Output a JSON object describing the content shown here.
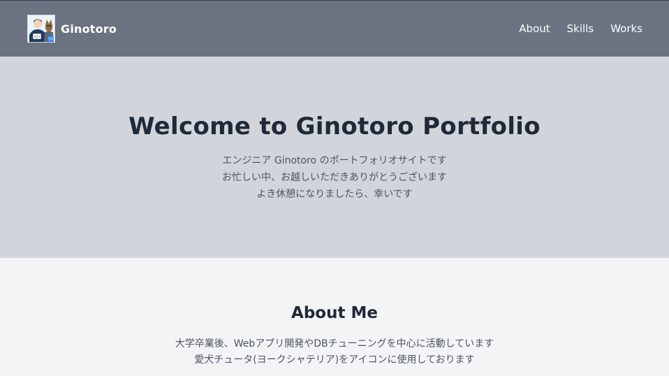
{
  "header": {
    "brand_name": "Ginotoro",
    "logo_icon": "avatar-with-dog-icon",
    "nav": [
      {
        "label": "About"
      },
      {
        "label": "Skills"
      },
      {
        "label": "Works"
      }
    ]
  },
  "hero": {
    "title": "Welcome to Ginotoro Portfolio",
    "lines": [
      "エンジニア Ginotoro のポートフォリオサイトです",
      "お忙しい中、お越しいただきありがとうございます",
      "よき休憩になりましたら、幸いです"
    ]
  },
  "about": {
    "title": "About Me",
    "lines": [
      "大学卒業後、Webアプリ開発やDBチューニングを中心に活動しています",
      "愛犬チュータ(ヨークシャテリア)をアイコンに使用しております"
    ]
  },
  "colors": {
    "header_bg": "#6b7280",
    "hero_bg": "#d1d5db",
    "page_bg": "#f3f4f6",
    "heading": "#1f2937",
    "body_text": "#4b5563"
  }
}
